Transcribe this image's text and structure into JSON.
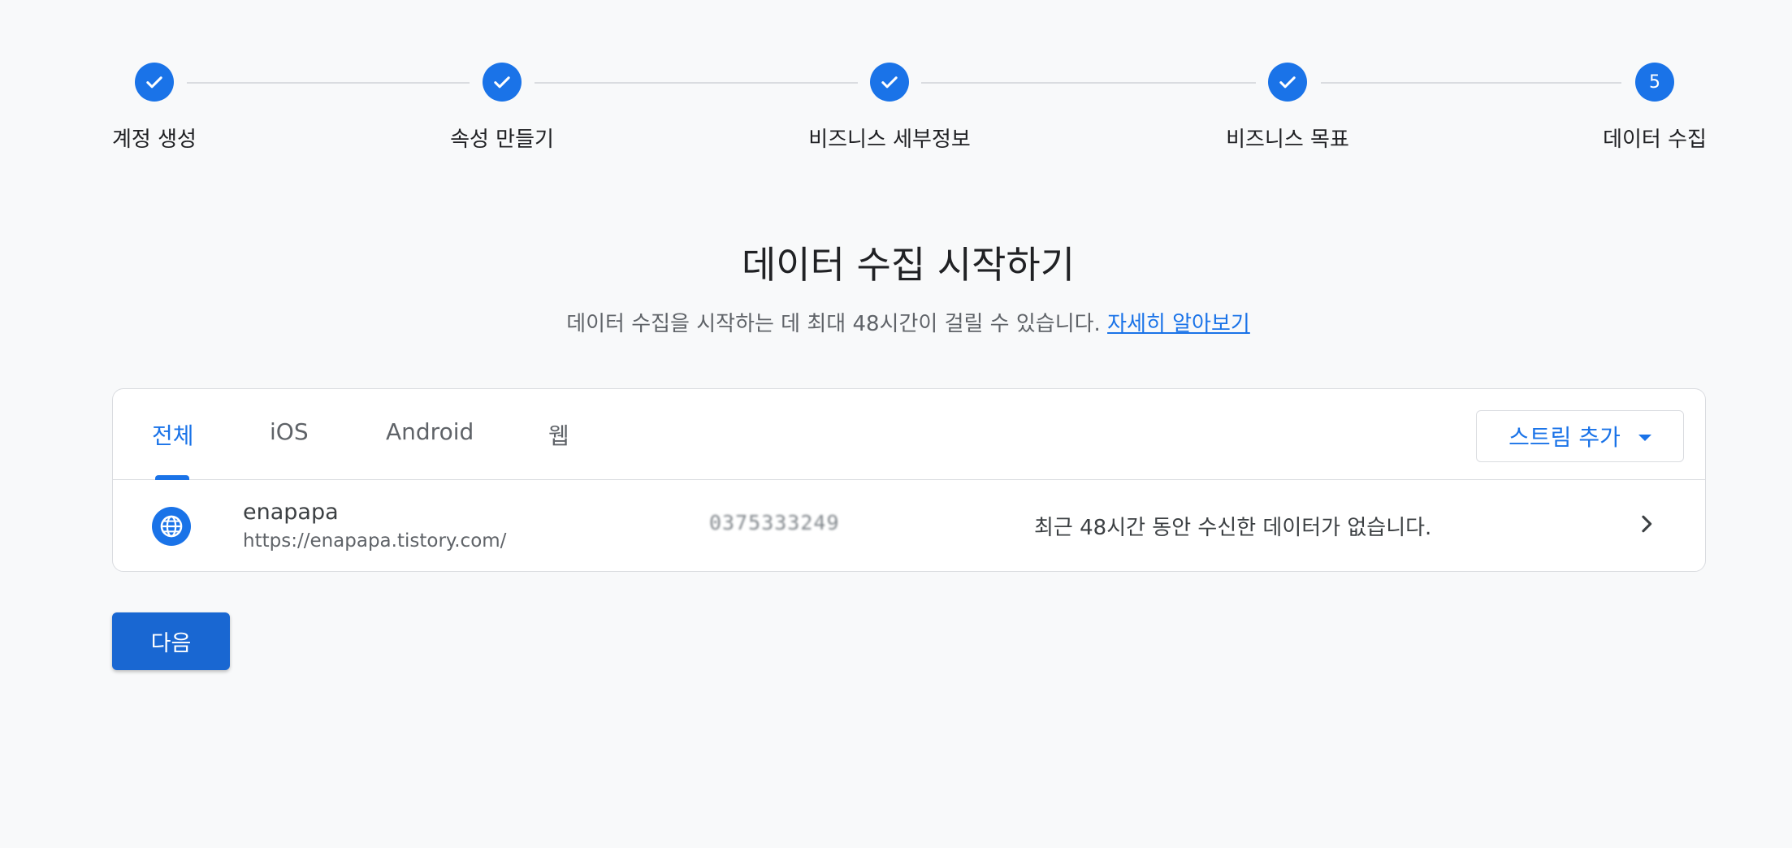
{
  "stepper": {
    "steps": [
      {
        "label": "계정 생성",
        "state": "done"
      },
      {
        "label": "속성 만들기",
        "state": "done"
      },
      {
        "label": "비즈니스 세부정보",
        "state": "done"
      },
      {
        "label": "비즈니스 목표",
        "state": "done"
      },
      {
        "label": "데이터 수집",
        "state": "current",
        "number": "5"
      }
    ]
  },
  "main": {
    "title": "데이터 수집 시작하기",
    "subtitle": "데이터 수집을 시작하는 데 최대 48시간이 걸릴 수 있습니다.",
    "learn_more": "자세히 알아보기"
  },
  "streams_card": {
    "tabs": [
      {
        "label": "전체",
        "active": true
      },
      {
        "label": "iOS",
        "active": false
      },
      {
        "label": "Android",
        "active": false
      },
      {
        "label": "웹",
        "active": false
      }
    ],
    "add_stream_label": "스트림 추가",
    "rows": [
      {
        "icon": "globe-icon",
        "name": "enapapa",
        "url": "https://enapapa.tistory.com/",
        "stream_id": "0375333249",
        "status": "최근 48시간 동안 수신한 데이터가 없습니다."
      }
    ]
  },
  "footer": {
    "next_label": "다음"
  },
  "colors": {
    "accent": "#1a73e8",
    "button": "#1967d2",
    "background": "#f8f9fa"
  }
}
